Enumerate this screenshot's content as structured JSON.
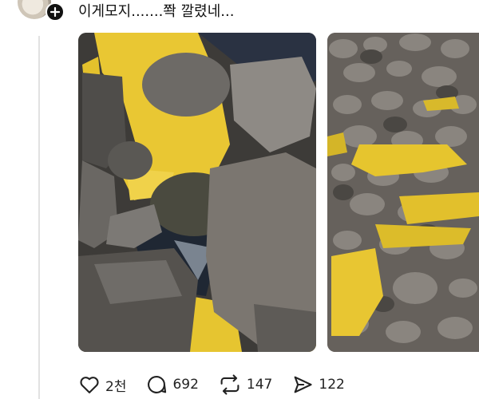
{
  "post": {
    "caption": "이게모지.......쫙 깔렸네..."
  },
  "actions": {
    "likes": "2천",
    "comments": "692",
    "reposts": "147",
    "shares": "122"
  },
  "icons": [
    "avatar",
    "plus-icon",
    "heart-icon",
    "comment-icon",
    "repost-icon",
    "share-icon"
  ],
  "colors": {
    "text": "#111111",
    "thread": "#e2e2e2",
    "pollen": "#e8c62a"
  }
}
